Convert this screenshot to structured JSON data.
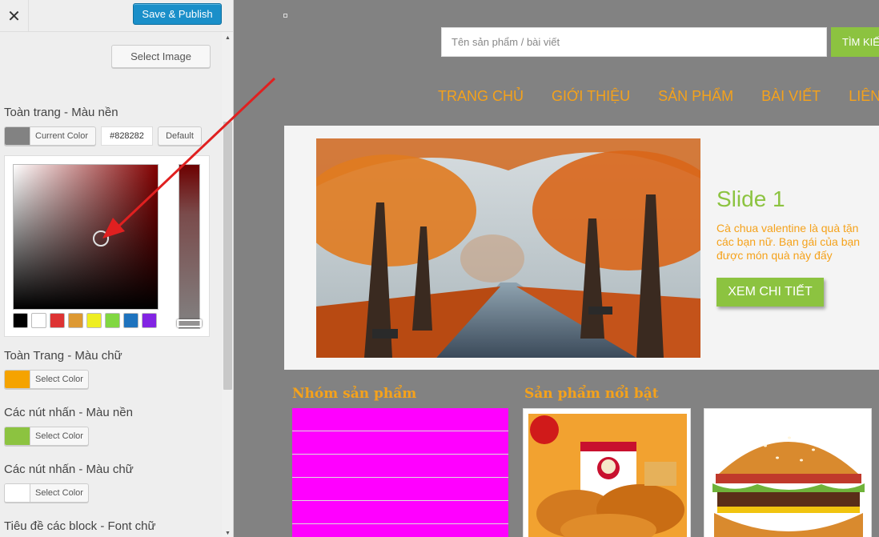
{
  "sidebar": {
    "close_icon": "close-icon",
    "publish_label": "Save & Publish",
    "select_image_label": "Select Image",
    "sections": [
      {
        "label": "Toàn trang - Màu nền",
        "button": "Current Color",
        "swatch": "#828282"
      },
      {
        "label": "Toàn Trang - Màu chữ",
        "button": "Select Color",
        "swatch": "#f5a300"
      },
      {
        "label": "Các nút nhấn - Màu nền",
        "button": "Select Color",
        "swatch": "#8cc340"
      },
      {
        "label": "Các nút nhấn - Màu chữ",
        "button": "Select Color",
        "swatch": "#ffffff"
      },
      {
        "label": "Tiêu đề các block - Font chữ"
      }
    ],
    "hex_value": "#828282",
    "default_label": "Default",
    "palette": [
      "#000000",
      "#ffffff",
      "#dd3333",
      "#dd9933",
      "#eeee22",
      "#81d742",
      "#1e73be",
      "#8224e3"
    ]
  },
  "preview": {
    "search_placeholder": "Tên sản phẩm / bài viết",
    "search_button": "TÌM KIẾ",
    "nav": [
      "TRANG CHỦ",
      "GIỚI THIỆU",
      "SẢN PHẨM",
      "BÀI VIẾT",
      "LIÊN"
    ],
    "slide": {
      "title": "Slide 1",
      "desc_lines": [
        "Cà chua valentine là quà tặn",
        "các bạn nữ. Bạn gái của bạn",
        "được món quà này đấy"
      ],
      "button": "XEM CHI TIẾT"
    },
    "group_title": "Nhóm sản phẩm",
    "featured_title": "Sản phẩm nổi bật",
    "category_rows": 6
  },
  "colors": {
    "accent_orange": "#f5a21b",
    "accent_green": "#8cc340",
    "page_bg": "#828282",
    "category_bg": "#ff00ff",
    "publish_blue": "#1a8fc9"
  }
}
